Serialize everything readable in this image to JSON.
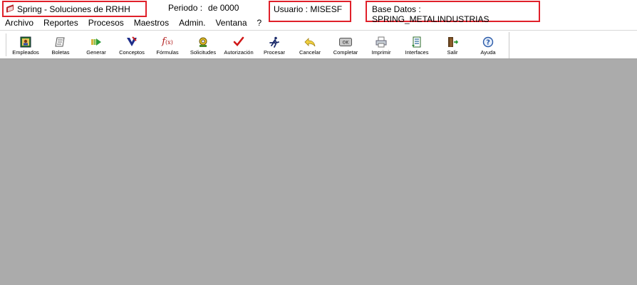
{
  "titlebar": {
    "app_title": "Spring - Soluciones de RRHH",
    "period_label": "Periodo :",
    "period_value": "de 0000",
    "user": "Usuario : MISESF",
    "database": "Base Datos : SPRING_METALINDUSTRIAS",
    "highlight_color": "#e0202a"
  },
  "menu": [
    "Archivo",
    "Reportes",
    "Procesos",
    "Maestros",
    "Admin.",
    "Ventana",
    "?"
  ],
  "toolbar": [
    {
      "label": "Empleados",
      "icon": "employees-icon"
    },
    {
      "label": "Boletas",
      "icon": "payslip-icon"
    },
    {
      "label": "Generar",
      "icon": "generate-icon"
    },
    {
      "label": "Conceptos",
      "icon": "concepts-icon"
    },
    {
      "label": "Fórmulas",
      "icon": "formula-icon"
    },
    {
      "label": "Solicitudes",
      "icon": "requests-icon"
    },
    {
      "label": "Autorización",
      "icon": "checkmark-icon"
    },
    {
      "label": "Procesar",
      "icon": "runner-icon"
    },
    {
      "label": "Cancelar",
      "icon": "undo-icon"
    },
    {
      "label": "Completar",
      "icon": "ok-icon"
    },
    {
      "label": "Imprimir",
      "icon": "printer-icon"
    },
    {
      "label": "Interfaces",
      "icon": "interfaces-icon"
    },
    {
      "label": "Salir",
      "icon": "exit-door-icon"
    },
    {
      "label": "Ayuda",
      "icon": "help-icon"
    }
  ],
  "colors": {
    "workspace": "#ababab"
  }
}
